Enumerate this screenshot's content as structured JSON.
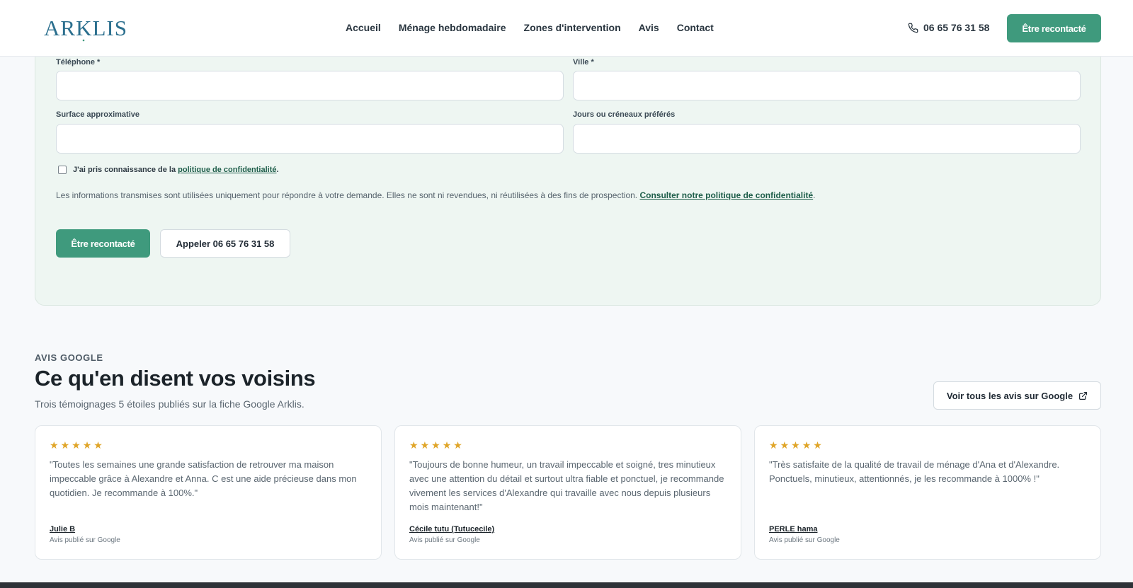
{
  "colors": {
    "accent": "#3f9a7d",
    "star": "#e0a528",
    "form_bg": "#eef6f2"
  },
  "header": {
    "logo_text": "ARKLIS",
    "nav": [
      {
        "label": "Accueil"
      },
      {
        "label": "Ménage hebdomadaire"
      },
      {
        "label": "Zones d'intervention"
      },
      {
        "label": "Avis"
      },
      {
        "label": "Contact"
      }
    ],
    "phone": "06 65 76 31 58",
    "cta_label": "Être recontacté"
  },
  "form": {
    "phone_label": "Téléphone *",
    "phone_value": "",
    "city_label": "Ville *",
    "city_value": "",
    "surface_label": "Surface approximative",
    "surface_value": "",
    "slots_label": "Jours ou créneaux préférés",
    "slots_value": "",
    "consent_prefix": "J'ai pris connaissance de la ",
    "consent_link": "politique de confidentialité",
    "consent_suffix": ".",
    "privacy_note": "Les informations transmises sont utilisées uniquement pour répondre à votre demande. Elles ne sont ni revendues, ni réutilisées à des fins de prospection. ",
    "privacy_link": "Consulter notre politique de confidentialité",
    "privacy_suffix": ".",
    "submit_label": "Être recontacté",
    "call_label": "Appeler 06 65 76 31 58"
  },
  "reviews": {
    "eyebrow": "AVIS GOOGLE",
    "title": "Ce qu'en disent vos voisins",
    "subtitle": "Trois témoignages 5 étoiles publiés sur la fiche Google Arklis.",
    "all_reviews_label": "Voir tous les avis sur Google",
    "items": [
      {
        "rating": 5,
        "text": "\"Toutes les semaines une grande satisfaction de retrouver ma maison impeccable grâce à Alexandre et Anna. C est une aide précieuse dans mon quotidien. Je recommande à 100%.\"",
        "author": "Julie B",
        "source": "Avis publié sur Google"
      },
      {
        "rating": 5,
        "text": "\"Toujours de bonne humeur, un travail impeccable et soigné, tres minutieux avec une attention du détail et surtout ultra fiable et ponctuel, je recommande vivement les services d'Alexandre qui travaille avec nous depuis plusieurs mois maintenant!\"",
        "author": "Cécile tutu (Tutucecile)",
        "source": "Avis publié sur Google"
      },
      {
        "rating": 5,
        "text": "\"Très satisfaite de la qualité de travail de ménage d'Ana et d'Alexandre. Ponctuels, minutieux, attentionnés, je les recommande à 1000% !\"",
        "author": "PERLE hama",
        "source": "Avis publié sur Google"
      }
    ]
  }
}
